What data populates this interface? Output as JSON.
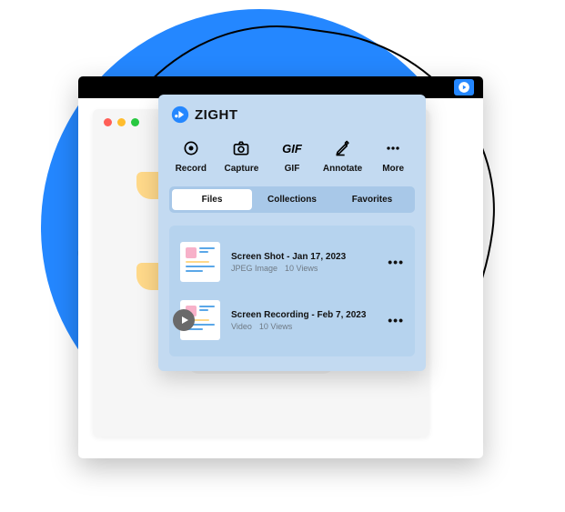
{
  "brand": {
    "name": "ZIGHT"
  },
  "toolbar": [
    {
      "label": "Record",
      "icon": "record-icon"
    },
    {
      "label": "Capture",
      "icon": "camera-icon"
    },
    {
      "label": "GIF",
      "icon": "gif-icon"
    },
    {
      "label": "Annotate",
      "icon": "pencil-icon"
    },
    {
      "label": "More",
      "icon": "more-icon"
    }
  ],
  "tabs": [
    {
      "label": "Files",
      "active": true
    },
    {
      "label": "Collections",
      "active": false
    },
    {
      "label": "Favorites",
      "active": false
    }
  ],
  "files": [
    {
      "title": "Screen Shot - Jan 17, 2023",
      "type": "JPEG Image",
      "views": "10 Views",
      "kind": "image"
    },
    {
      "title": "Screen Recording - Feb 7, 2023",
      "type": "Video",
      "views": "10 Views",
      "kind": "video"
    }
  ],
  "colors": {
    "accent": "#2487ff"
  }
}
